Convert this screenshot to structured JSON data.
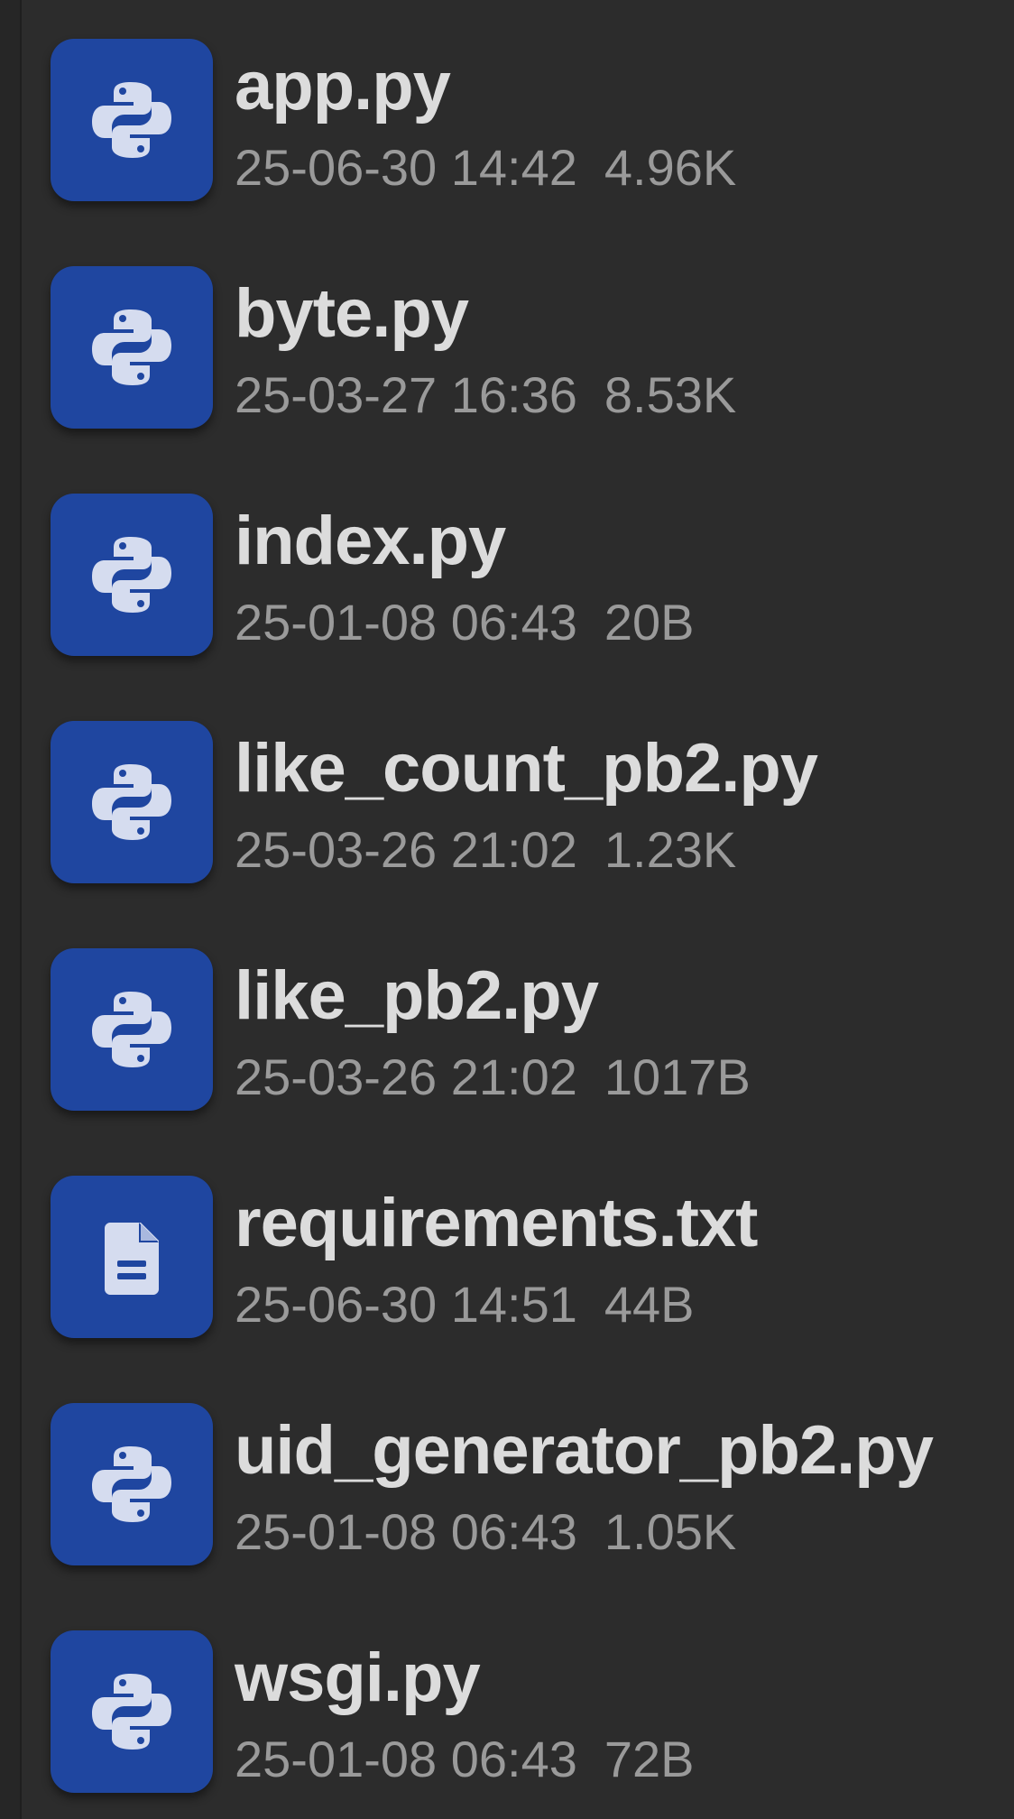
{
  "files": [
    {
      "name": "app.py",
      "date": "25-06-30 14:42",
      "size": "4.96K",
      "icon": "python-icon"
    },
    {
      "name": "byte.py",
      "date": "25-03-27 16:36",
      "size": "8.53K",
      "icon": "python-icon"
    },
    {
      "name": "index.py",
      "date": "25-01-08 06:43",
      "size": "20B",
      "icon": "python-icon"
    },
    {
      "name": "like_count_pb2.py",
      "date": "25-03-26 21:02",
      "size": "1.23K",
      "icon": "python-icon"
    },
    {
      "name": "like_pb2.py",
      "date": "25-03-26 21:02",
      "size": "1017B",
      "icon": "python-icon"
    },
    {
      "name": "requirements.txt",
      "date": "25-06-30 14:51",
      "size": "44B",
      "icon": "text-file-icon"
    },
    {
      "name": "uid_generator_pb2.py",
      "date": "25-01-08 06:43",
      "size": "1.05K",
      "icon": "python-icon"
    },
    {
      "name": "wsgi.py",
      "date": "25-01-08 06:43",
      "size": "72B",
      "icon": "python-icon"
    }
  ],
  "colors": {
    "background": "#2c2c2c",
    "icon_tile": "#1f46a0",
    "icon_glyph": "#d5dcef",
    "name_text": "#dcdcdc",
    "meta_text": "#9a9a9a"
  }
}
